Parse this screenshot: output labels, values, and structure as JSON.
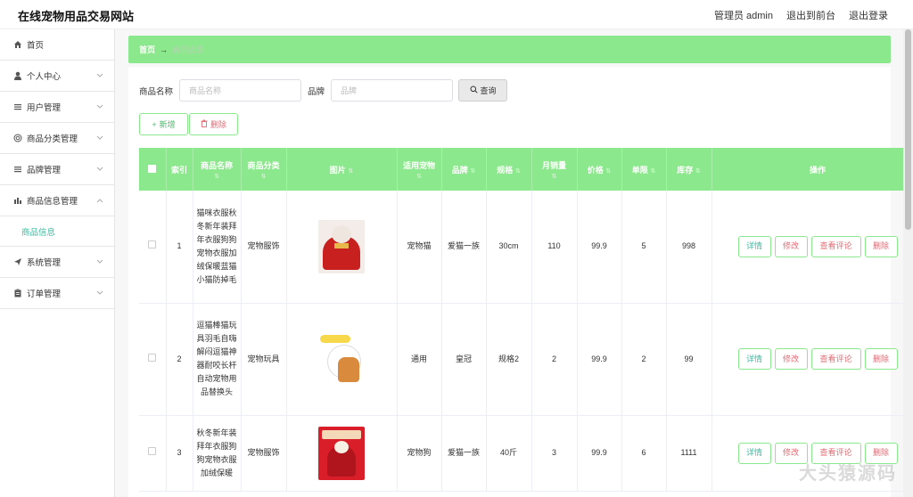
{
  "app": {
    "title": "在线宠物用品交易网站"
  },
  "topnav": {
    "admin": "管理员 admin",
    "front": "退出到前台",
    "logout": "退出登录"
  },
  "sidebar": {
    "items": [
      {
        "label": "首页",
        "icon": "home-icon"
      },
      {
        "label": "个人中心",
        "icon": "user-icon"
      },
      {
        "label": "用户管理",
        "icon": "list-icon"
      },
      {
        "label": "商品分类管理",
        "icon": "category-icon"
      },
      {
        "label": "品牌管理",
        "icon": "list-icon"
      },
      {
        "label": "商品信息管理",
        "icon": "chart-icon"
      },
      {
        "label": "系统管理",
        "icon": "send-icon"
      },
      {
        "label": "订单管理",
        "icon": "clipboard-icon"
      }
    ],
    "sub_active": "商品信息"
  },
  "breadcrumb": {
    "home": "首页",
    "current": "商品信息"
  },
  "search": {
    "name_label": "商品名称",
    "name_placeholder": "商品名称",
    "brand_label": "品牌",
    "brand_placeholder": "品牌",
    "button": "查询"
  },
  "actions": {
    "add": "新增",
    "delete": "删除"
  },
  "table": {
    "headers": [
      "索引",
      "商品名称",
      "商品分类",
      "图片",
      "适用宠物",
      "品牌",
      "规格",
      "月销量",
      "价格",
      "单限",
      "库存",
      "操作"
    ],
    "rows": [
      {
        "index": "1",
        "name": "猫咪衣服秋冬新年装拜年衣服狗狗宠物衣服加绒保暖蓝猫小猫防掉毛",
        "category": "宠物服饰",
        "pet": "宠物猫",
        "brand": "爱猫一族",
        "spec": "30cm",
        "sales": "110",
        "price": "99.9",
        "limit": "5",
        "stock": "998"
      },
      {
        "index": "2",
        "name": "逗猫棒猫玩具羽毛自嗨解闷逗猫神器耐咬长杆自动宠物用品替换头",
        "category": "宠物玩具",
        "pet": "通用",
        "brand": "皇冠",
        "spec": "规格2",
        "sales": "2",
        "price": "99.9",
        "limit": "2",
        "stock": "99"
      },
      {
        "index": "3",
        "name": "秋冬新年装拜年衣服狗狗宠物衣服加绒保暖",
        "category": "宠物服饰",
        "pet": "宠物狗",
        "brand": "爱猫一族",
        "spec": "40斤",
        "sales": "3",
        "price": "99.9",
        "limit": "6",
        "stock": "1111"
      }
    ],
    "ops": {
      "detail": "详情",
      "edit": "修改",
      "review": "查看评论",
      "delete": "删除"
    }
  },
  "watermark": "大头猿源码"
}
